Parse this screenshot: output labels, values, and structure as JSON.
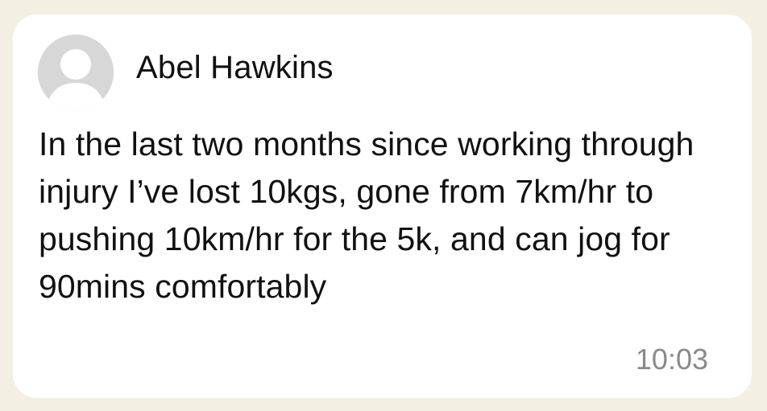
{
  "message": {
    "sender_name": "Abel Hawkins",
    "avatar_icon": "default-user-avatar-icon",
    "body": "In the last two months since working through injury I’ve lost 10kgs, gone from 7km/hr to pushing 10km/hr for the 5k, and can jog for 90mins comfortably",
    "timestamp": "10:03"
  },
  "colors": {
    "page_background": "#f3efe2",
    "card_background": "#ffffff",
    "avatar_background": "#d7d7d7",
    "avatar_figure": "#ffffff",
    "text_primary": "#111111",
    "text_secondary": "#8a8a8a"
  }
}
